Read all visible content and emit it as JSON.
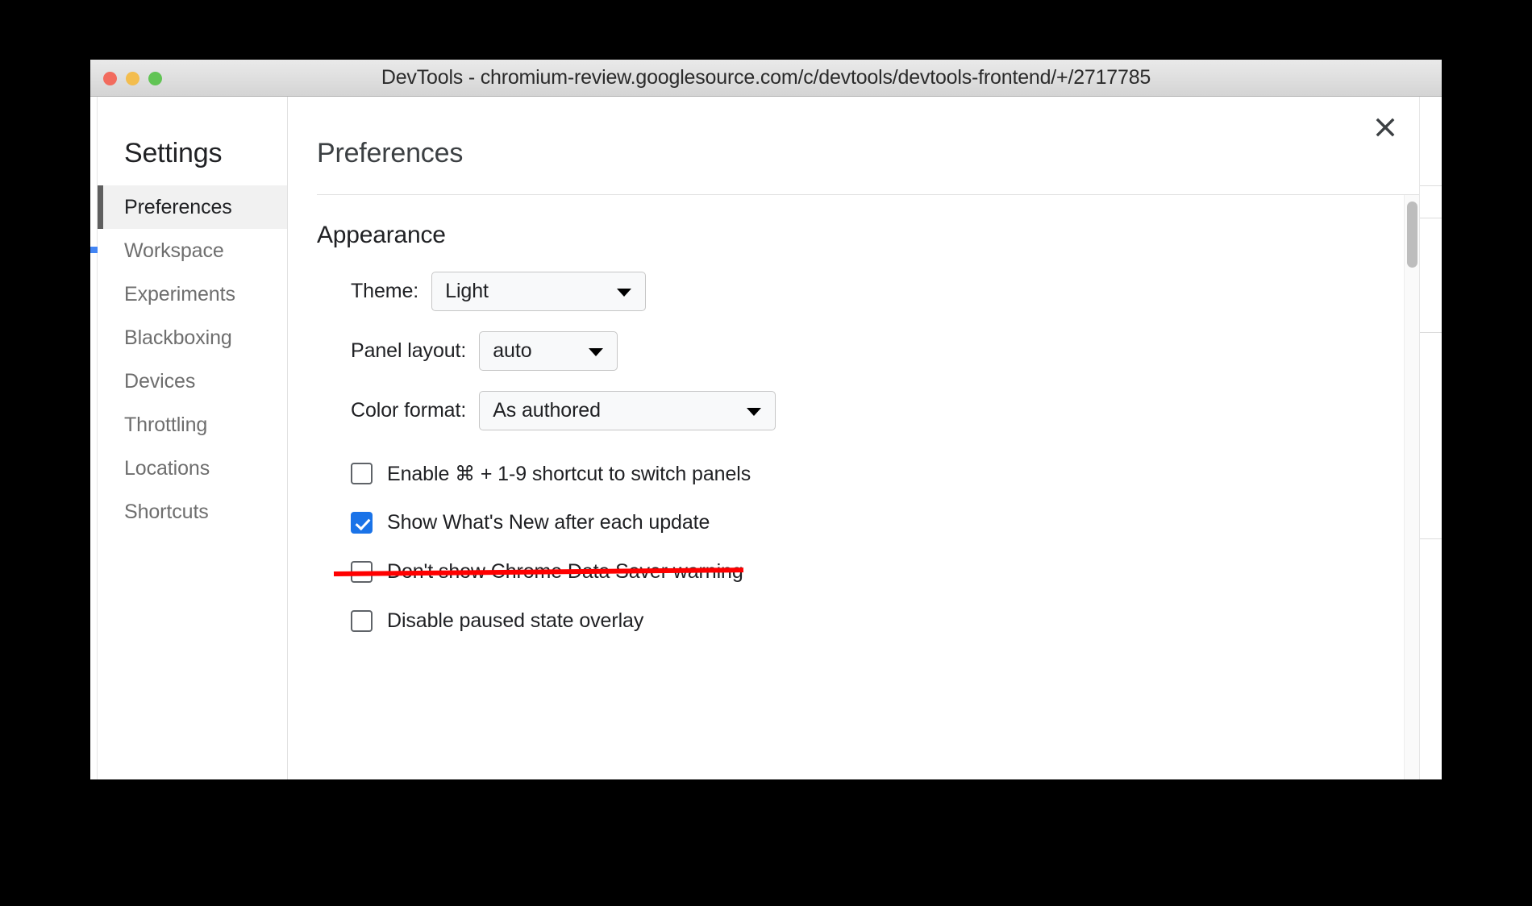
{
  "window": {
    "title": "DevTools - chromium-review.googlesource.com/c/devtools/devtools-frontend/+/2717785",
    "traffic_lights": {
      "close_color": "#f26b5e",
      "minimize_color": "#f3bd4e",
      "zoom_color": "#61c454"
    }
  },
  "dialog": {
    "close_label": "×",
    "sidebar": {
      "title": "Settings",
      "items": [
        {
          "label": "Preferences",
          "selected": true
        },
        {
          "label": "Workspace",
          "selected": false
        },
        {
          "label": "Experiments",
          "selected": false
        },
        {
          "label": "Blackboxing",
          "selected": false
        },
        {
          "label": "Devices",
          "selected": false
        },
        {
          "label": "Throttling",
          "selected": false
        },
        {
          "label": "Locations",
          "selected": false
        },
        {
          "label": "Shortcuts",
          "selected": false
        }
      ]
    },
    "main": {
      "title": "Preferences",
      "sections": [
        {
          "title": "Appearance",
          "fields": [
            {
              "label": "Theme:",
              "value": "Light"
            },
            {
              "label": "Panel layout:",
              "value": "auto"
            },
            {
              "label": "Color format:",
              "value": "As authored"
            }
          ],
          "checkboxes": [
            {
              "label": "Enable ⌘ + 1-9 shortcut to switch panels",
              "checked": false,
              "struck": false
            },
            {
              "label": "Show What's New after each update",
              "checked": true,
              "struck": false
            },
            {
              "label": "Don't show Chrome Data Saver warning",
              "checked": false,
              "struck": true
            },
            {
              "label": "Disable paused state overlay",
              "checked": false,
              "struck": false
            }
          ]
        }
      ]
    }
  },
  "colors": {
    "accent": "#1a73e8",
    "strikethrough": "#ff0000",
    "selected_row_background": "#f1f1f1",
    "selected_row_indicator": "#5f5f5f",
    "text_primary": "#202124",
    "text_muted": "#6e6e6e"
  }
}
